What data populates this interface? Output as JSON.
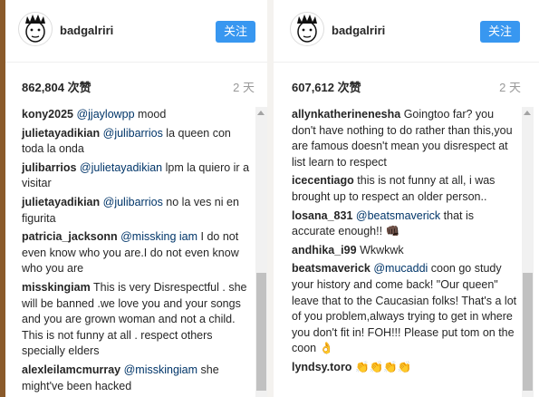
{
  "panels": [
    {
      "username": "badgalriri",
      "follow_label": "关注",
      "likes": "862,804 次赞",
      "time_ago": "2 天",
      "comments": [
        {
          "user": "kony2025",
          "mention": "@jjaylowpp",
          "text": " mood"
        },
        {
          "user": "julietayadikian",
          "mention": "@julibarrios",
          "text": " la queen con toda la onda"
        },
        {
          "user": "julibarrios",
          "mention": "@julietayadikian",
          "text": " lpm la quiero ir a visitar"
        },
        {
          "user": "julietayadikian",
          "mention": "@julibarrios",
          "text": " no la ves ni en figurita"
        },
        {
          "user": "patricia_jacksonn",
          "mention": "@missking iam",
          "text": " I do not even know who you are.I do not even know who you are"
        },
        {
          "user": "misskingiam",
          "mention": "",
          "text": " This is very Disrespectful . she will be banned .we love you and your songs and you are grown woman and not a child. This is not funny at all . respect others specially elders"
        },
        {
          "user": "alexleilamcmurray",
          "mention": "@misskingiam",
          "text": " she might've been hacked"
        }
      ]
    },
    {
      "username": "badgalriri",
      "follow_label": "关注",
      "likes": "607,612 次赞",
      "time_ago": "2 天",
      "comments": [
        {
          "user": "allynkatherinenesha",
          "mention": "",
          "text": " Goingtoo far? you don't have nothing to do rather than this,you are famous doesn't mean you disrespect at list learn to respect"
        },
        {
          "user": "icecentiago",
          "mention": "",
          "text": " this is not funny at all, i was brought up to respect an older person.."
        },
        {
          "user": "losana_831",
          "mention": "@beatsmaverick",
          "text": " that is accurate enough!! 👊🏿"
        },
        {
          "user": "andhika_i99",
          "mention": "",
          "text": " Wkwkwk"
        },
        {
          "user": "beatsmaverick",
          "mention": "@mucaddi",
          "text": " coon go study your history and come back! \"Our queen\" leave that to the Caucasian folks! That's a lot of you problem,always trying to get in where you don't fit in! FOH!!! Please put tom on the coon 👌"
        },
        {
          "user": "lyndsy.toro",
          "mention": "",
          "text": " 👏👏👏👏"
        }
      ]
    }
  ]
}
